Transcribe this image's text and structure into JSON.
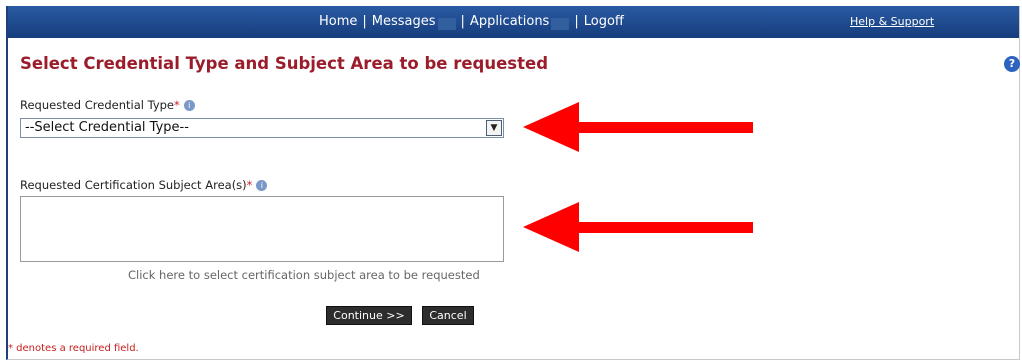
{
  "nav": {
    "items": [
      "Home",
      "Messages",
      "Applications",
      "Logoff"
    ],
    "help_label": "Help & Support"
  },
  "page": {
    "title": "Select Credential Type and Subject Area to be requested",
    "help_icon": "?"
  },
  "form": {
    "credential_type": {
      "label": "Requested Credential Type",
      "required_mark": "*",
      "info_icon": "info-icon",
      "selected": "--Select Credential Type--"
    },
    "subject_area": {
      "label": "Requested Certification Subject Area(s)",
      "required_mark": "*",
      "info_icon": "info-icon",
      "value": "",
      "hint": "Click here to select certification subject area to be requested"
    },
    "buttons": {
      "continue": "Continue >>",
      "cancel": "Cancel"
    }
  },
  "footnote": "* denotes a required field.",
  "colors": {
    "nav_bg": "#1f4d90",
    "title": "#9b1d2b",
    "required": "#cc1f1f",
    "arrow": "#ff0000"
  }
}
